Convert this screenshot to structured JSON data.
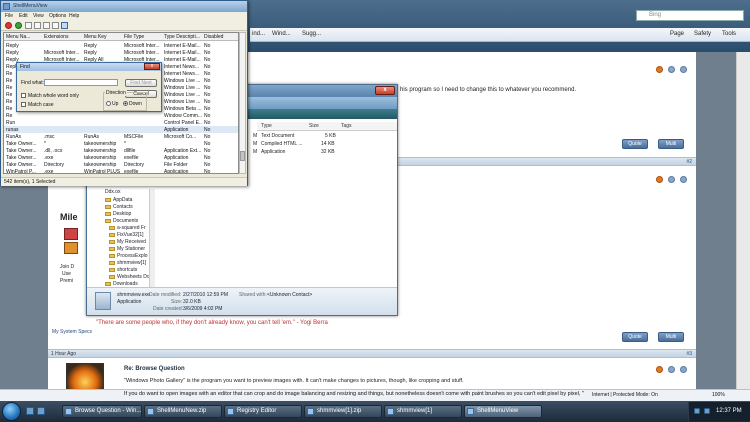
{
  "browser": {
    "search_placeholder": "Bing",
    "command_bar": [
      {
        "label": "Page"
      },
      {
        "label": "Safety"
      },
      {
        "label": "Tools"
      }
    ],
    "fav_links": [
      "ind...",
      "Wind...",
      "Sugg..."
    ],
    "status_text": "Internet | Protected Mode: On",
    "zoom": "100%"
  },
  "forum": {
    "post1_text": "his program so I need to change this to whatever you recommend.",
    "post2_number": "#2",
    "post3_number": "#3",
    "post_time": "1 Hour Ago",
    "quote_label": "Quote",
    "multi_label": "Multi",
    "sidebar_fragments": [
      "Mile",
      "Join D",
      "Use",
      "Premi"
    ],
    "signature": "\"There are some people who, if they don't already know, you can't tell 'em.\" - Yogi Berra",
    "system_specs": "My System Specs",
    "reply_title": "Re: Browse Question",
    "reply_line1": "\"Windows Photo Gallery\" is the program you want to preview images with. It can't make changes to pictures, though, like cropping and stuff.",
    "reply_line2": "If you do want to open images with an editor that can crop and do image balancing and resizing and things, but nonetheless doesn't come with paint brushes so you can't edit pixel by pixel, \"Microsoft Office Picture"
  },
  "explorer": {
    "columns": [
      "Type",
      "Size",
      "Tags"
    ],
    "files": [
      {
        "date": "M",
        "type": "Text Document",
        "size": "5 KB"
      },
      {
        "date": "M",
        "type": "Compiled HTML ...",
        "size": "14 KB"
      },
      {
        "date": "M",
        "type": "Application",
        "size": "32 KB"
      }
    ],
    "tree": [
      "Ddx.ox",
      "AppData",
      "Contacts",
      "Desktop",
      "Documents",
      "a-squared Fr",
      "FixVue32[1]",
      "My Received",
      "My Stationer",
      "ProcessExplo",
      "shmmview[1]",
      "shortcuts",
      "Websheets Do",
      "Downloads"
    ],
    "details": {
      "filename": "shmmview.exe",
      "type": "Application",
      "modified_label": "Date modified:",
      "modified": "2/27/2010 12:59 PM",
      "size_label": "Size:",
      "size": "32.0 KB",
      "created_label": "Date created:",
      "created": "3/6/2009 4:02 PM",
      "shared_label": "Shared with:",
      "shared": "<Unknown Contact>"
    }
  },
  "smv": {
    "title": "ShellMenuView",
    "menu": [
      "File",
      "Edit",
      "View",
      "Options",
      "Help"
    ],
    "columns": [
      "Menu Na...",
      "Extensions",
      "Menu Key",
      "File Type",
      "Type Descripti...",
      "Disabled"
    ],
    "rows": [
      [
        "Reply",
        "",
        "Reply",
        "Microsoft Inter...",
        "Internet E-Mail...",
        "No"
      ],
      [
        "Reply",
        "Microsoft Inter...",
        "Reply",
        "Microsoft Inter...",
        "Internet E-Mail...",
        "No"
      ],
      [
        "Reply",
        "Microsoft Inter...",
        "Reply All",
        "Microsoft Inter...",
        "Internet E-Mail...",
        "No"
      ],
      [
        "Reply",
        "Microsoft Inter...",
        "Forward",
        "Microsoft Inter...",
        "Internet News...",
        "No"
      ],
      [
        "Re",
        "",
        "",
        "Microsoft Inter...",
        "Internet News...",
        "No"
      ],
      [
        "Re",
        "",
        "",
        "",
        "Windows Live ...",
        "No"
      ],
      [
        "Re",
        "",
        "",
        "",
        "Windows Live ...",
        "No"
      ],
      [
        "Re",
        "",
        "",
        "",
        "Windows Live ...",
        "No"
      ],
      [
        "Re",
        "",
        "",
        "",
        "Windows Live ...",
        "No"
      ],
      [
        "Re",
        "",
        "",
        "",
        "Windows Beta ...",
        "No"
      ],
      [
        "Re",
        "",
        "",
        "",
        "Window Comm...",
        "No"
      ],
      [
        "Run",
        "",
        "",
        "",
        "Control Panel E...",
        "No"
      ],
      [
        "runas",
        "",
        "",
        "",
        "Application",
        "No"
      ],
      [
        "RunAs",
        ".msc",
        "RunAs",
        "MSCFile",
        "Microsoft Co...",
        "No"
      ],
      [
        "Take Owner...",
        "*",
        "takeownership",
        "*",
        "",
        "No"
      ],
      [
        "Take Owner...",
        ".dll, .ocx",
        "takeownership",
        "dllfile",
        "Application Ext...",
        "No"
      ],
      [
        "Take Owner...",
        ".exe",
        "takeownership",
        "exefile",
        "Application",
        "No"
      ],
      [
        "Take Owner...",
        "Directory",
        "takeownership",
        "Directory",
        "File Folder",
        "No"
      ],
      [
        "WinPatrol P...",
        ".exe",
        "WinPatrol PLUS",
        "exefile",
        "Application",
        "No"
      ]
    ],
    "status": "542 item(s), 1 Selected"
  },
  "find": {
    "title": "Find",
    "find_what_label": "Find what:",
    "find_what_value": "",
    "find_next": "Find Next",
    "cancel": "Cancel",
    "match_whole_word": "Match whole word only",
    "match_case": "Match case",
    "direction_label": "Direction",
    "up": "Up",
    "down": "Down"
  },
  "taskbar": {
    "buttons": [
      {
        "label": "Browse Question - Win..."
      },
      {
        "label": "ShellMenuNew.zip"
      },
      {
        "label": "Registry Editor"
      },
      {
        "label": "shmmview[1].zip"
      },
      {
        "label": "shmmview[1]"
      },
      {
        "label": "ShellMenuView"
      }
    ],
    "clock": "12:37 PM"
  }
}
